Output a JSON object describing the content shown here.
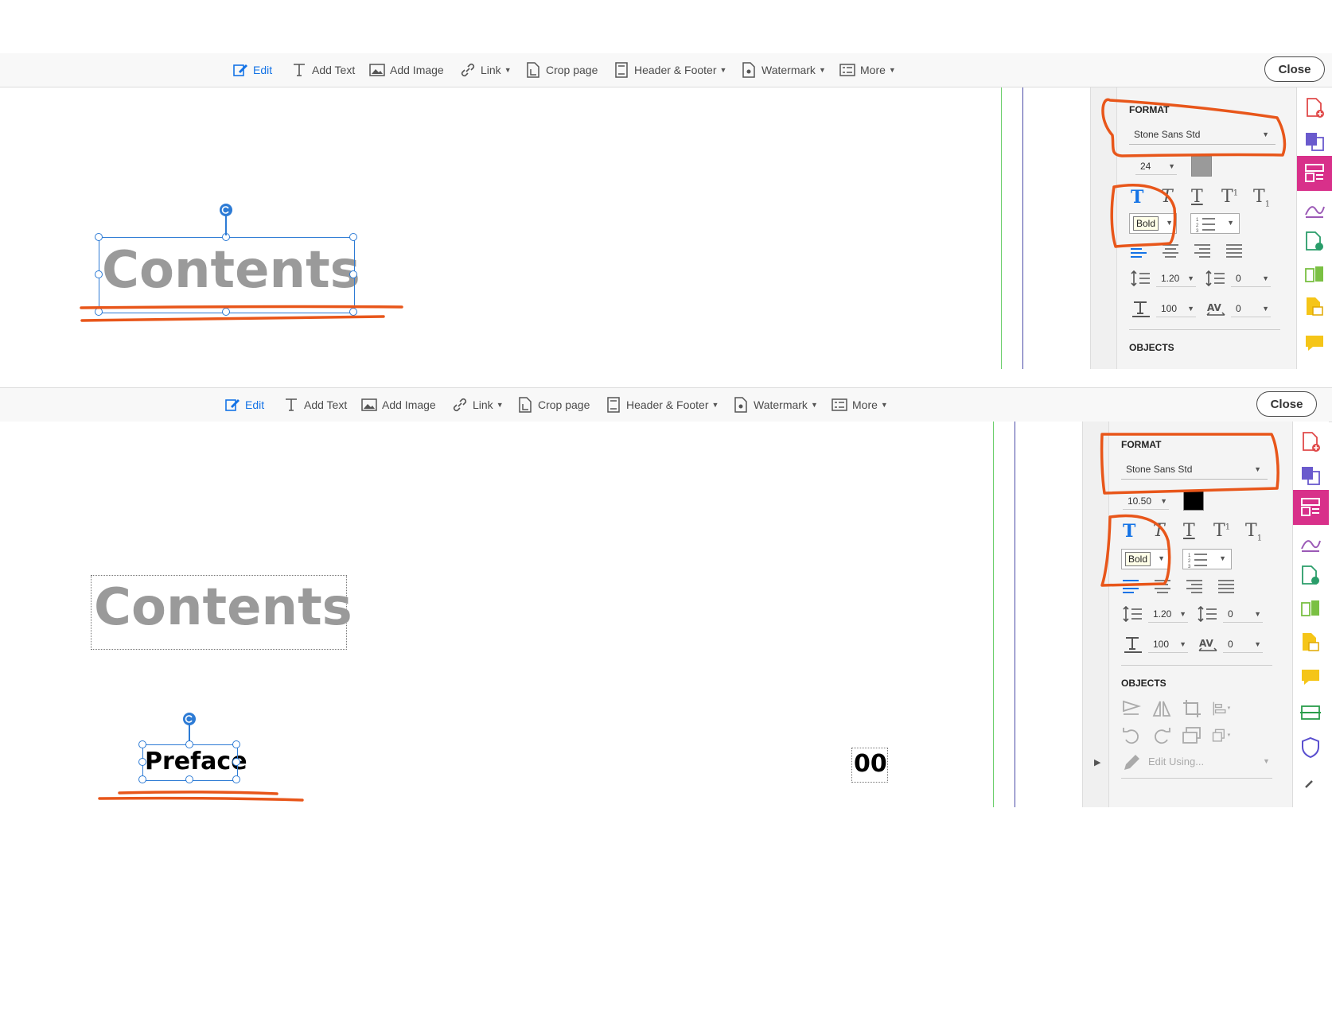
{
  "toolbar": {
    "edit": "Edit",
    "add_text": "Add Text",
    "add_image": "Add Image",
    "link": "Link",
    "crop_page": "Crop page",
    "header_footer": "Header & Footer",
    "watermark": "Watermark",
    "more": "More",
    "close": "Close"
  },
  "top_panel": {
    "format_title": "FORMAT",
    "font_name": "Stone Sans Std",
    "font_size": "24",
    "font_color": "#9a9a9a",
    "bold_tooltip": "Bold",
    "line_spacing": "1.20",
    "paragraph_spacing": "0",
    "horizontal_scaling": "100",
    "char_spacing": "0",
    "objects_title": "OBJECTS",
    "doc_heading": "Contents"
  },
  "bottom_panel": {
    "format_title": "FORMAT",
    "font_name": "Stone Sans Std",
    "font_size": "10.50",
    "font_color": "#000000",
    "bold_tooltip": "Bold",
    "line_spacing": "1.20",
    "paragraph_spacing": "0",
    "horizontal_scaling": "100",
    "char_spacing": "0",
    "objects_title": "OBJECTS",
    "edit_using": "Edit Using...",
    "doc_heading": "Contents",
    "doc_selected_text": "Preface",
    "doc_page_number": "00"
  },
  "colors": {
    "accent_blue": "#1473e6",
    "annotation_orange": "#e8561a",
    "rail_active": "#d8308a"
  }
}
